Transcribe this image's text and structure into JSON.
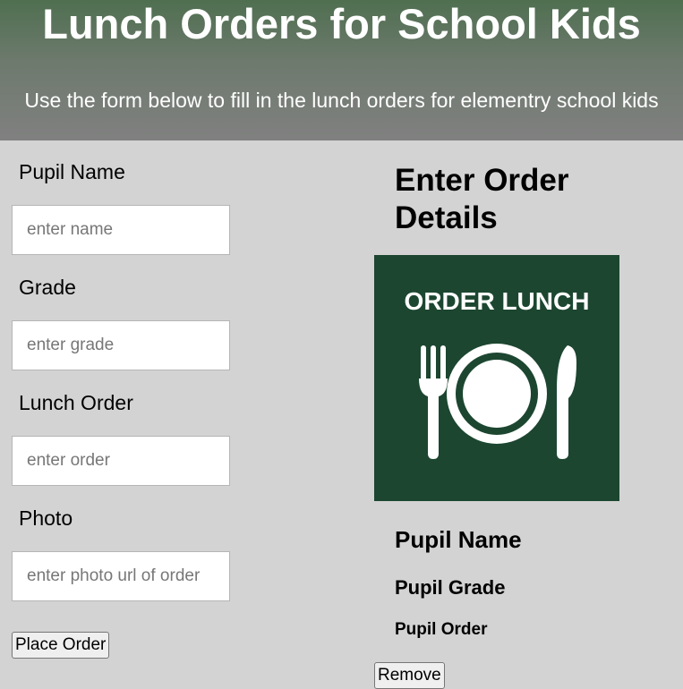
{
  "header": {
    "title": "Lunch Orders for School Kids",
    "subtitle": "Use the form below to fill in the lunch orders for elementry school kids"
  },
  "form": {
    "pupil_name_label": "Pupil Name",
    "pupil_name_placeholder": "enter name",
    "grade_label": "Grade",
    "grade_placeholder": "enter grade",
    "lunch_order_label": "Lunch Order",
    "lunch_order_placeholder": "enter order",
    "photo_label": "Photo",
    "photo_placeholder": "enter photo url of order",
    "submit_label": "Place Order"
  },
  "order_details": {
    "heading": "Enter Order Details",
    "image_text": "ORDER LUNCH",
    "pupil_name": "Pupil Name",
    "pupil_grade": "Pupil Grade",
    "pupil_order": "Pupil Order",
    "remove_label": "Remove"
  },
  "colors": {
    "page_background": "#d3d3d3",
    "header_gradient_top": "#4f6f50",
    "header_gradient_bottom": "#808080",
    "image_background": "#1c4630"
  },
  "icons": {
    "order_image": "plate-fork-knife-icon"
  }
}
